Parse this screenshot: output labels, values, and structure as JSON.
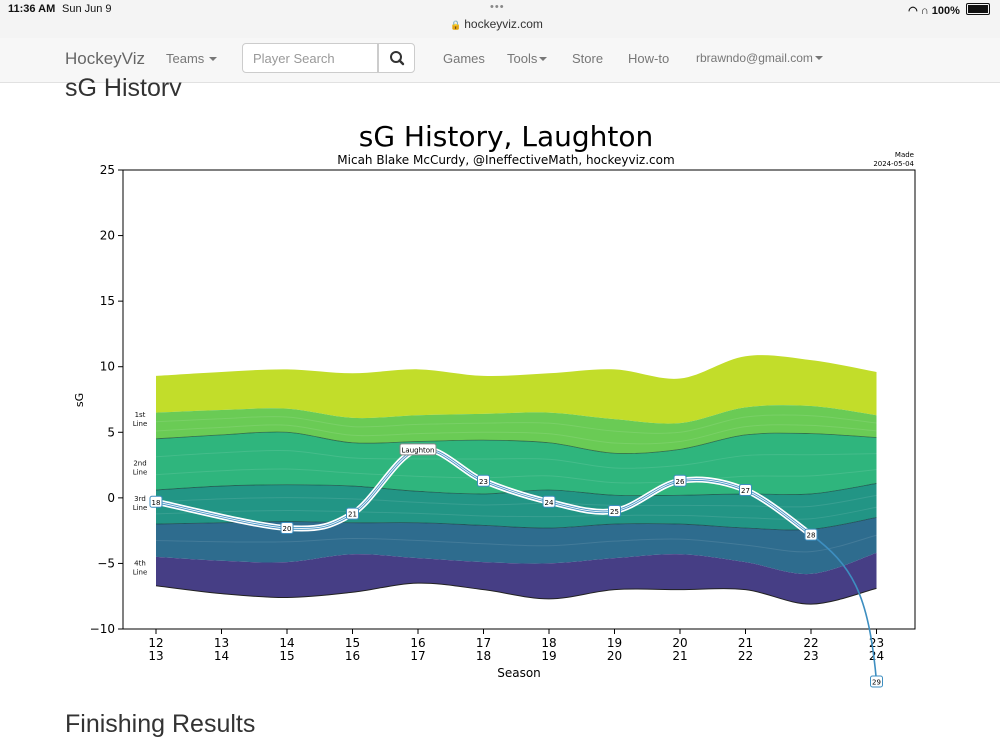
{
  "status_bar": {
    "time": "11:36 AM",
    "date": "Sun Jun 9",
    "battery": "100%",
    "url": "hockeyviz.com"
  },
  "navbar": {
    "brand": "HockeyViz",
    "teams": "Teams",
    "search_placeholder": "Player Search",
    "games": "Games",
    "tools": "Tools",
    "store": "Store",
    "howto": "How-to",
    "account": "rbrawndo@gmail.com"
  },
  "sections": {
    "sg_history": "sG History",
    "finishing": "Finishing Results"
  },
  "chart_data": {
    "type": "line",
    "title": "sG History, Laughton",
    "subtitle": "Micah Blake McCurdy, @IneffectiveMath, hockeyviz.com",
    "made_label": "Made",
    "made_date": "2024-05-04",
    "xlabel": "Season",
    "ylabel": "sG",
    "ylim": [
      -10,
      25
    ],
    "yticks": [
      25,
      20,
      15,
      10,
      5,
      0,
      -5,
      -10
    ],
    "ytick_labels": [
      "25",
      "20",
      "15",
      "10",
      "5",
      "0",
      "−5",
      "−10"
    ],
    "seasons": [
      "12\n13",
      "13\n14",
      "14\n15",
      "15\n16",
      "16\n17",
      "17\n18",
      "18\n19",
      "19\n20",
      "20\n21",
      "21\n22",
      "22\n23",
      "23\n24"
    ],
    "season_top": [
      "12",
      "13",
      "14",
      "15",
      "16",
      "17",
      "18",
      "19",
      "20",
      "21",
      "22",
      "23"
    ],
    "season_bottom": [
      "13",
      "14",
      "15",
      "16",
      "17",
      "18",
      "19",
      "20",
      "21",
      "22",
      "23",
      "24"
    ],
    "band_top": [
      9.3,
      9.6,
      9.8,
      9.5,
      9.8,
      9.3,
      9.5,
      9.8,
      9.1,
      10.8,
      10.5,
      9.6
    ],
    "band_divisions": [
      [
        6.5,
        6.7,
        6.8,
        6.1,
        6.3,
        6.4,
        6.5,
        6.0,
        5.7,
        6.9,
        7.0,
        6.3
      ],
      [
        4.5,
        4.8,
        5.0,
        4.2,
        4.3,
        4.4,
        4.2,
        3.4,
        3.7,
        4.8,
        4.9,
        4.6
      ],
      [
        0.6,
        0.9,
        1.0,
        0.9,
        0.5,
        0.3,
        0.6,
        0.2,
        0.2,
        0.3,
        0.3,
        1.1
      ],
      [
        -2.0,
        -1.9,
        -1.8,
        -1.9,
        -1.9,
        -2.1,
        -2.3,
        -2.0,
        -2.0,
        -2.3,
        -2.4,
        -1.5
      ],
      [
        -4.5,
        -4.8,
        -4.9,
        -4.3,
        -4.6,
        -4.9,
        -5.0,
        -4.6,
        -4.3,
        -4.9,
        -5.8,
        -4.2
      ]
    ],
    "band_bottom": [
      -6.7,
      -7.3,
      -7.6,
      -7.2,
      -6.5,
      -7.0,
      -7.7,
      -7.0,
      -7.0,
      -7.0,
      -8.1,
      -6.9
    ],
    "line_labels": [
      {
        "text": "1st Line",
        "y": 6.0
      },
      {
        "text": "2nd Line",
        "y": 2.3
      },
      {
        "text": "3rd Line",
        "y": -0.4
      },
      {
        "text": "4th Line",
        "y": -5.3
      }
    ],
    "series": [
      {
        "name": "Laughton",
        "points": [
          {
            "season": "12 13",
            "value": -0.3,
            "label": "18"
          },
          {
            "season": "14 15",
            "value": -2.3,
            "label": "20"
          },
          {
            "season": "15 16",
            "value": -1.2,
            "label": "21"
          },
          {
            "season": "16 17",
            "value": 3.7,
            "label": "Laughton"
          },
          {
            "season": "17 18",
            "value": 1.3,
            "label": "23"
          },
          {
            "season": "18 19",
            "value": -0.3,
            "label": "24"
          },
          {
            "season": "19 20",
            "value": -1.0,
            "label": "25"
          },
          {
            "season": "20 21",
            "value": 1.3,
            "label": "26"
          },
          {
            "season": "21 22",
            "value": 0.6,
            "label": "27"
          },
          {
            "season": "22 23",
            "value": -2.8,
            "label": "28"
          },
          {
            "season": "23 24",
            "value": -14.0,
            "label": "29"
          }
        ]
      }
    ],
    "colors": {
      "band1": "#c2dd2a",
      "band2": "#6acb55",
      "band3": "#2fb57d",
      "band4": "#229585",
      "band5": "#2e6c8e",
      "band6": "#463e85",
      "line": "#3d8ec0"
    }
  }
}
